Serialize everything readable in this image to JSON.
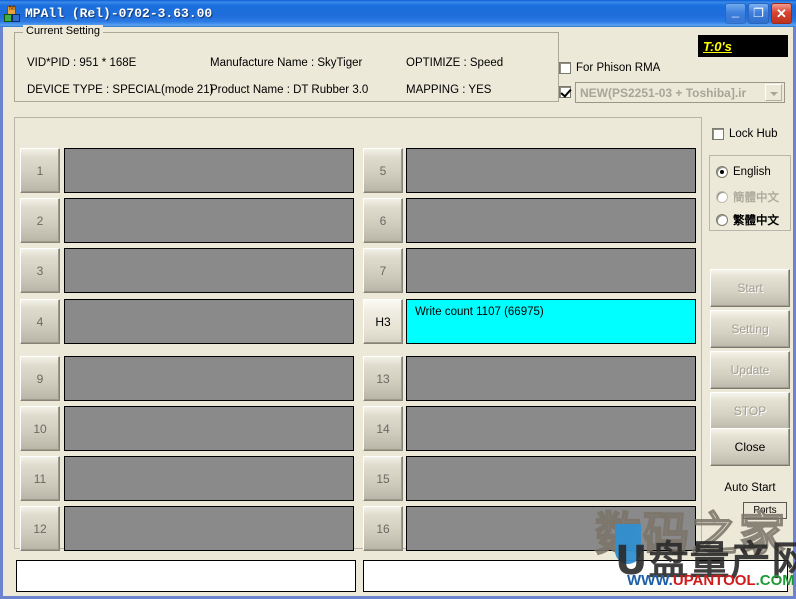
{
  "window": {
    "title": "MPAll (Rel)-0702-3.63.00",
    "icon": "app-blocks-icon",
    "minimize_label": "_",
    "maximize_label": "❐",
    "close_label": "✕"
  },
  "current_setting": {
    "legend": "Current Setting",
    "vid_pid": "VID*PID :  951 * 168E",
    "device_type": "DEVICE TYPE : SPECIAL(mode 21)",
    "manufacture_name": "Manufacture Name : SkyTiger",
    "product_name": "Product Name : DT Rubber 3.0",
    "optimize": "OPTIMIZE : Speed",
    "mapping": "MAPPING : YES"
  },
  "top_right": {
    "timer_label": "T:0's",
    "timer_color": "#ffff00",
    "phison_rma_label": "For Phison RMA",
    "phison_rma_checked": false,
    "config_checked": true,
    "config_value": "NEW(PS2251-03 + Toshiba].ir",
    "lock_hub_label": "Lock Hub",
    "lock_hub_checked": false
  },
  "language": {
    "options": [
      {
        "label": "English",
        "selected": true,
        "disabled": false
      },
      {
        "label": "簡體中文",
        "selected": false,
        "disabled": true
      },
      {
        "label": "繁體中文",
        "selected": false,
        "disabled": false
      }
    ]
  },
  "ports": {
    "left_column": [
      {
        "label": "1",
        "text": "",
        "state": "idle"
      },
      {
        "label": "2",
        "text": "",
        "state": "idle"
      },
      {
        "label": "3",
        "text": "",
        "state": "idle"
      },
      {
        "label": "4",
        "text": "",
        "state": "idle"
      },
      {
        "label": "9",
        "text": "",
        "state": "idle"
      },
      {
        "label": "10",
        "text": "",
        "state": "idle"
      },
      {
        "label": "11",
        "text": "",
        "state": "idle"
      },
      {
        "label": "12",
        "text": "",
        "state": "idle"
      }
    ],
    "right_column": [
      {
        "label": "5",
        "text": "",
        "state": "idle"
      },
      {
        "label": "6",
        "text": "",
        "state": "idle"
      },
      {
        "label": "7",
        "text": "",
        "state": "idle"
      },
      {
        "label": "H3",
        "text": "Write count 1107 (66975)",
        "state": "active"
      },
      {
        "label": "13",
        "text": "",
        "state": "idle"
      },
      {
        "label": "14",
        "text": "",
        "state": "idle"
      },
      {
        "label": "15",
        "text": "",
        "state": "idle"
      },
      {
        "label": "16",
        "text": "",
        "state": "idle"
      }
    ],
    "idle_color": "#8a8a8a",
    "active_color": "#00ffff"
  },
  "actions": {
    "start": {
      "label": "Start",
      "enabled": false
    },
    "setting": {
      "label": "Setting",
      "enabled": false
    },
    "update": {
      "label": "Update",
      "enabled": false
    },
    "stop": {
      "label": "STOP",
      "enabled": false
    },
    "close": {
      "label": "Close",
      "enabled": true
    },
    "auto_start_label": "Auto Start",
    "ports_label": "Ports"
  },
  "status": {
    "left_value": "",
    "right_value": ""
  },
  "watermark": {
    "cn_top": "数码之家",
    "cn_bottom": "U盘量产网",
    "url_w": "WWW.",
    "url_u": "UPANTOOL",
    "url_c": ".COM"
  }
}
